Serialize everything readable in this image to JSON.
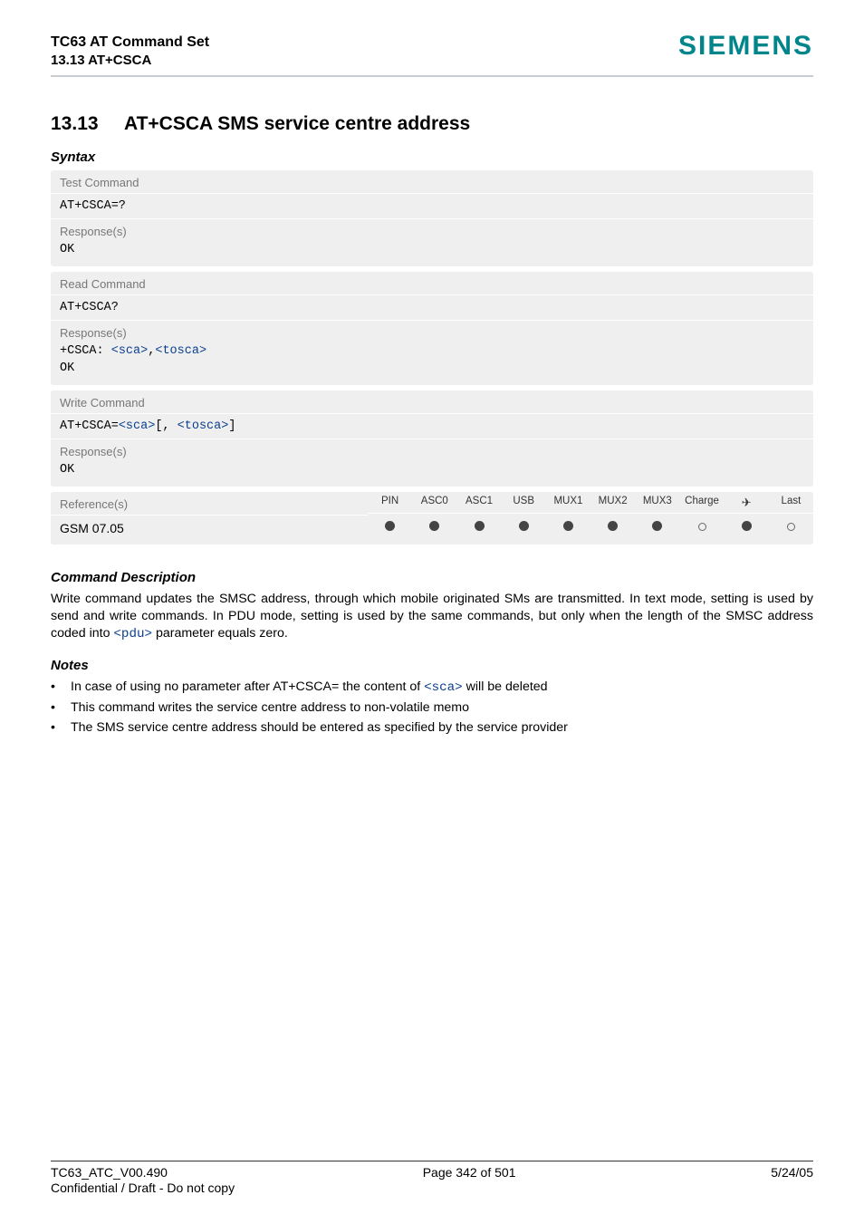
{
  "header": {
    "line1": "TC63 AT Command Set",
    "line2": "13.13 AT+CSCA",
    "brand": "SIEMENS"
  },
  "section": {
    "number": "13.13",
    "title": "AT+CSCA   SMS service centre address"
  },
  "syntax_label": "Syntax",
  "blocks": {
    "test": {
      "label": "Test Command",
      "cmd": "AT+CSCA=?",
      "resp_label": "Response(s)",
      "resp": "OK"
    },
    "read": {
      "label": "Read Command",
      "cmd": "AT+CSCA?",
      "resp_label": "Response(s)",
      "resp_prefix": "+CSCA: ",
      "resp_p1": "<sca>",
      "resp_sep": ",",
      "resp_p2": "<tosca>",
      "resp_ok": "OK"
    },
    "write": {
      "label": "Write Command",
      "cmd_prefix": "AT+CSCA=",
      "cmd_p1": "<sca>",
      "cmd_mid1": "[, ",
      "cmd_p2": "<tosca>",
      "cmd_mid2": "]",
      "resp_label": "Response(s)",
      "resp": "OK"
    }
  },
  "ref": {
    "head": "Reference(s)",
    "body": "GSM 07.05",
    "cols": [
      "PIN",
      "ASC0",
      "ASC1",
      "USB",
      "MUX1",
      "MUX2",
      "MUX3",
      "Charge",
      "✈",
      "Last"
    ],
    "marks": [
      "full",
      "full",
      "full",
      "full",
      "full",
      "full",
      "full",
      "empty",
      "full",
      "empty"
    ]
  },
  "desc": {
    "title": "Command Description",
    "body_a": "Write command updates the SMSC address, through which mobile originated SMs are transmitted. In text mode, setting is used by send and write commands. In PDU mode, setting is used by the same commands, but only when the length of the SMSC address coded into ",
    "body_param": "<pdu>",
    "body_b": " parameter equals zero."
  },
  "notes": {
    "title": "Notes",
    "items": [
      {
        "pre": "In case of using no parameter after AT+CSCA= the content of ",
        "param": "<sca>",
        "post": " will be deleted"
      },
      {
        "pre": "This command writes the service centre address to non-volatile memo",
        "param": "",
        "post": ""
      },
      {
        "pre": "The SMS service centre address should be entered as specified by the service provider",
        "param": "",
        "post": ""
      }
    ]
  },
  "footer": {
    "left": "TC63_ATC_V00.490",
    "center": "Page 342 of 501",
    "right": "5/24/05",
    "line2": "Confidential / Draft - Do not copy"
  }
}
